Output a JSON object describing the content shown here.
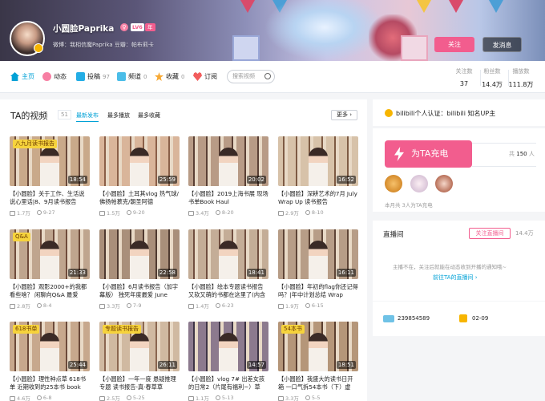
{
  "header": {
    "username": "小圆脸Paprika",
    "gender": "♀",
    "level": "LV6",
    "vip": "年",
    "signature": "微博：我相信魔Paprika  豆瓣：帕布莉卡",
    "follow_label": "关注",
    "message_label": "发消息"
  },
  "nav": {
    "items": [
      {
        "label": "主页",
        "count": ""
      },
      {
        "label": "动态",
        "count": ""
      },
      {
        "label": "投稿",
        "count": "97"
      },
      {
        "label": "频道",
        "count": "0"
      },
      {
        "label": "收藏",
        "count": "0"
      },
      {
        "label": "订阅",
        "count": ""
      }
    ],
    "search_placeholder": "搜索视频",
    "stats": [
      {
        "label": "关注数",
        "value": "37"
      },
      {
        "label": "粉丝数",
        "value": "14.4万"
      },
      {
        "label": "播放数",
        "value": "111.8万"
      }
    ]
  },
  "videos": {
    "title": "TA的视频",
    "count": "51",
    "tabs": [
      "最新发布",
      "最多播放",
      "最多收藏"
    ],
    "more_label": "更多",
    "items": [
      {
        "title": "【小圆脸】关于工作、生活说说心里话|8、9月读书报告",
        "views": "1.7万",
        "date": "9-27",
        "duration": "18:54",
        "tag": "八九月读书报告"
      },
      {
        "title": "【小圆脸】土耳其vlog 热气球/佛扬帕慕克/朝圣阿德",
        "views": "1.5万",
        "date": "9-20",
        "duration": "25:59",
        "tag": ""
      },
      {
        "title": "【小圆脸】2019上海书展 现场书单Book Haul",
        "views": "3.4万",
        "date": "8-20",
        "duration": "20:02",
        "tag": ""
      },
      {
        "title": "【小圆脸】深耕艺术的7月 July Wrap Up 读书报告",
        "views": "2.9万",
        "date": "8-10",
        "duration": "16:52",
        "tag": ""
      },
      {
        "title": "【小圆脸】观影2000+的我都看些啥？ 闲聊向Q&A 最爱",
        "views": "2.8万",
        "date": "8-4",
        "duration": "21:33",
        "tag": "Q&A"
      },
      {
        "title": "【小圆脸】6月读书报告（加字幕版） 独死年度最爱 June",
        "views": "3.3万",
        "date": "7-9",
        "duration": "22:58",
        "tag": ""
      },
      {
        "title": "【小圆脸】绘本专题读书报告 又软又萌的书都在这里了(内含",
        "views": "1.4万",
        "date": "6-23",
        "duration": "18:41",
        "tag": ""
      },
      {
        "title": "【小圆脸】年初的flag你还记得吗？|年中计划总结 Wrap",
        "views": "1.9万",
        "date": "6-15",
        "duration": "16:11",
        "tag": ""
      },
      {
        "title": "【小圆脸】理性种点草 618书单 近期收到的25本书 book",
        "views": "4.6万",
        "date": "6-8",
        "duration": "25:44",
        "tag": "618书单"
      },
      {
        "title": "【小圆脸】一年一度 悬疑推理专题 读书报告-真·春草草",
        "views": "2.5万",
        "date": "5-25",
        "duration": "26:11",
        "tag": "专题读书报告"
      },
      {
        "title": "【小圆脸】vlog 7# 出差女孩的日常2（片尾有福利~）草",
        "views": "1.1万",
        "date": "5-13",
        "duration": "14:57",
        "tag": ""
      },
      {
        "title": "【小圆脸】我盛大的读书日开箱 一口气拆54本书（下）虚",
        "views": "3.3万",
        "date": "5-5",
        "duration": "18:51",
        "tag": "54本书"
      }
    ]
  },
  "sidebar": {
    "certification": "bilibili个人认证：bilibili 知名UP主",
    "charge_label": "为TA充电",
    "charge_total_prefix": "共",
    "charge_total": "150",
    "charge_total_suffix": "人",
    "charge_month": "本月共 3人为TA充电",
    "live_title": "直播间",
    "live_follow": "关注直播间",
    "live_count": "14.4万",
    "live_hint": "主播不在，关注后就能在动态收到开播的通知哦~",
    "live_link": "前往TA的直播间 ›",
    "uid": "239854589",
    "birthday": "02-09"
  },
  "colors": {
    "accent": "#00a1d6",
    "pink": "#f25d8e"
  }
}
